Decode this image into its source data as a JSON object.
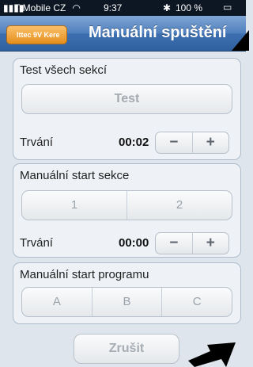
{
  "status_bar": {
    "carrier": "T-Mobile CZ",
    "time": "9:37",
    "battery": "100 %"
  },
  "nav": {
    "back_label": "Ittec 9V Kere",
    "title": "Manuální spuštění"
  },
  "test_section": {
    "title": "Test všech sekcí",
    "button_label": "Test",
    "duration_label": "Trvání",
    "duration_value": "00:02"
  },
  "manual_section": {
    "title": "Manuální start sekce",
    "options": [
      "1",
      "2"
    ],
    "duration_label": "Trvání",
    "duration_value": "00:00"
  },
  "program_section": {
    "title": "Manuální start programu",
    "options": [
      "A",
      "B",
      "C"
    ]
  },
  "controls": {
    "minus": "−",
    "plus": "+"
  },
  "cancel_button": "Zrušit",
  "icons": [
    "signal-bars-icon",
    "wifi-icon",
    "bluetooth-icon",
    "battery-icon",
    "arrow-icon"
  ]
}
